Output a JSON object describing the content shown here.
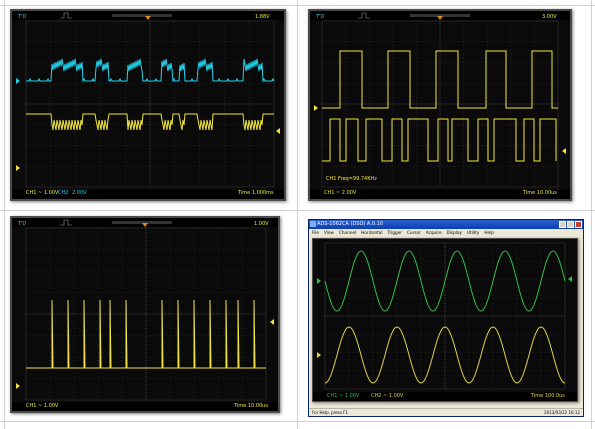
{
  "colors": {
    "ch1_yellow": "#f0e53a",
    "ch2_cyan": "#22d6f0",
    "pc_ch1_green": "#2fbf4a",
    "pc_ch2_yellow": "#e0d24a",
    "screen_bg": "#0a0a0a",
    "grid_dot": "#3a3a3a"
  },
  "scope1": {
    "status": "T'D",
    "trig_level": "1.88V",
    "ch1_scale": "CH1 ~ 1.00V",
    "ch2_scale": "CH2",
    "ch2_volt": "2.00V",
    "time": "Time 1.000ms"
  },
  "scope2": {
    "status": "T'D",
    "trig_level": "3.00V",
    "ch1_scale": "CH1 ~ 2.00V",
    "measurement": "CH1 Freq=99.74KHz",
    "time": "Time 10.00us"
  },
  "scope3": {
    "status": "T'D",
    "trig_level": "1.00V",
    "ch1_scale": "CH1 ~ 1.00V",
    "time": "Time 10.00us"
  },
  "pc_window": {
    "title": "ADS-1062CA (DSO) A.0.10",
    "menu": [
      "File",
      "View",
      "Channel",
      "Horizontal",
      "Trigger",
      "Cursor",
      "Acquire",
      "Display",
      "Utility",
      "Help"
    ],
    "ch1_scale": "CH1 ~ 1.00V",
    "ch2_scale": "CH2 ~ 1.00V",
    "time": "Time 100.0us",
    "status_left": "For Help, press F1",
    "status_right": "2013/03/22  16:12"
  }
}
